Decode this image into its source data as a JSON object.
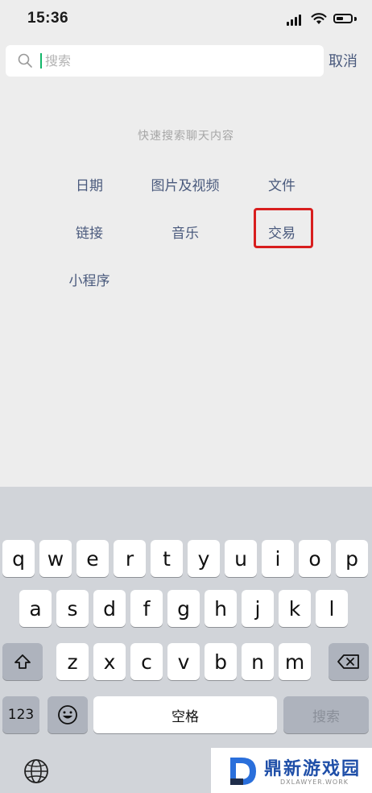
{
  "status_bar": {
    "time": "15:36"
  },
  "search": {
    "placeholder": "搜索",
    "cancel_label": "取消"
  },
  "quick_search": {
    "title": "快速搜索聊天内容",
    "categories": [
      "日期",
      "图片及视频",
      "文件",
      "链接",
      "音乐",
      "交易",
      "小程序"
    ],
    "highlighted": "交易",
    "highlight_color": "#d81e1e"
  },
  "keyboard": {
    "row1": [
      "q",
      "w",
      "e",
      "r",
      "t",
      "y",
      "u",
      "i",
      "o",
      "p"
    ],
    "row2": [
      "a",
      "s",
      "d",
      "f",
      "g",
      "h",
      "j",
      "k",
      "l"
    ],
    "row3": [
      "z",
      "x",
      "c",
      "v",
      "b",
      "n",
      "m"
    ],
    "numbers_label": "123",
    "space_label": "空格",
    "search_label": "搜索"
  },
  "colors": {
    "accent": "#4a5a7d",
    "cursor": "#12b76a",
    "background": "#ededed",
    "keyboard_bg": "#d1d4d9"
  },
  "watermark": {
    "brand": "鼎新游戏园",
    "domain": "DXLAWYER.WORK"
  }
}
